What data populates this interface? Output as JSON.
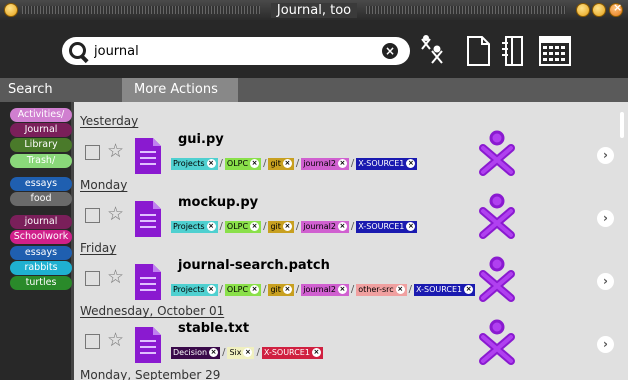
{
  "window": {
    "title": "Journal, too"
  },
  "search": {
    "value": "journal",
    "placeholder": ""
  },
  "toolbar": {
    "icons": [
      "favorites-filter-icon",
      "document-icon",
      "tag-panel-icon",
      "calendar-icon"
    ]
  },
  "tabs": [
    {
      "label": "Search"
    },
    {
      "label": "More Actions"
    }
  ],
  "sidebar": {
    "tags": [
      {
        "label": "Activities",
        "color": "#d07fd0",
        "suffix": "/"
      },
      {
        "label": "Journal",
        "color": "#7a1f5a"
      },
      {
        "label": "Library",
        "color": "#4a7a2a"
      },
      {
        "label": "Trash",
        "color": "#8ad87a",
        "suffix": "/"
      },
      {
        "label": "essays",
        "color": "#1f5fb0"
      },
      {
        "label": "food",
        "color": "#6a6a6a"
      },
      {
        "label": "journal",
        "color": "#7a1f5a"
      },
      {
        "label": "Schoolwork",
        "color": "#d0208a"
      },
      {
        "label": "essays",
        "color": "#1f5fb0"
      },
      {
        "label": "rabbits",
        "color": "#1fb0d0"
      },
      {
        "label": "turtles",
        "color": "#2a8a2a"
      }
    ]
  },
  "days": [
    {
      "label": "Yesterday"
    },
    {
      "label": "Monday"
    },
    {
      "label": "Friday"
    },
    {
      "label": "Wednesday, October 01"
    },
    {
      "label": "Monday, September 29"
    }
  ],
  "entries": [
    {
      "title": "gui.py",
      "tags": [
        {
          "label": "Projects",
          "color": "#4fd0d0"
        },
        {
          "label": "OLPC",
          "color": "#8ae04a"
        },
        {
          "label": "git",
          "color": "#c8a020"
        },
        {
          "label": "journal2",
          "color": "#d060d0"
        },
        {
          "label": "X-SOURCE1",
          "color": "#1a1ab0",
          "dark": true
        }
      ]
    },
    {
      "title": "mockup.py",
      "tags": [
        {
          "label": "Projects",
          "color": "#4fd0d0"
        },
        {
          "label": "OLPC",
          "color": "#8ae04a"
        },
        {
          "label": "git",
          "color": "#c8a020"
        },
        {
          "label": "journal2",
          "color": "#d060d0"
        },
        {
          "label": "X-SOURCE1",
          "color": "#1a1ab0",
          "dark": true
        }
      ]
    },
    {
      "title": "journal-search.patch",
      "tags": [
        {
          "label": "Projects",
          "color": "#4fd0d0"
        },
        {
          "label": "OLPC",
          "color": "#8ae04a"
        },
        {
          "label": "git",
          "color": "#c8a020"
        },
        {
          "label": "journal2",
          "color": "#d060d0"
        },
        {
          "label": "other-src",
          "color": "#f0a0a0"
        },
        {
          "label": "X-SOURCE1",
          "color": "#1a1ab0",
          "dark": true
        }
      ]
    },
    {
      "title": "stable.txt",
      "tags": [
        {
          "label": "Decision",
          "color": "#3a0a4a",
          "dark": true
        },
        {
          "label": "Six",
          "color": "#f0f0c0"
        },
        {
          "label": "X-SOURCE1",
          "color": "#d02040",
          "dark": true
        }
      ]
    }
  ],
  "colors": {
    "accent_purple": "#8a1ad0",
    "toolbar_bg": "#282828"
  }
}
